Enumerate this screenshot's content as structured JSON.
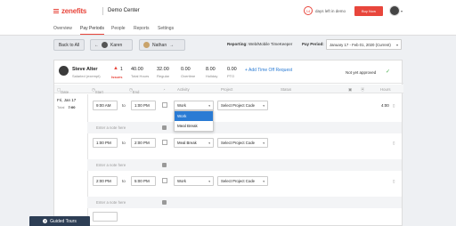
{
  "brand": {
    "name": "zenefits",
    "company": "Demo Center"
  },
  "trial": {
    "days": "14",
    "text": "days left in demo",
    "buy_label": "Buy Now"
  },
  "nav": [
    "Overview",
    "Pay Periods",
    "People",
    "Reports",
    "Settings"
  ],
  "toolbar": {
    "back_label": "Back to All",
    "prev_person": "Karen",
    "next_person": "Nathan",
    "reporting_label": "Reporting:",
    "reporting_value": "Web/Mobile TimeKeeper",
    "pay_period_label": "Pay Period:",
    "pay_period_value": "January 17 - Feb 01, 2020 (Current)"
  },
  "employee": {
    "name": "Steve Alter",
    "type": "Salaried (exempt)",
    "issues_count": "1",
    "issues_label": "Issues",
    "stats": [
      {
        "value": "40.00",
        "label": "Total Hours"
      },
      {
        "value": "32.00",
        "label": "Regular"
      },
      {
        "value": "0.00",
        "label": "Overtime"
      },
      {
        "value": "8.00",
        "label": "Holiday"
      },
      {
        "value": "0.00",
        "label": "PTO"
      }
    ],
    "add_timeoff": "+ Add Time Off Request",
    "status": "Not yet approved"
  },
  "columns": {
    "date": "Date",
    "start": "Start",
    "end": "End",
    "activity": "Activity",
    "project": "Project",
    "status": "Status",
    "hours": "Hours"
  },
  "day": {
    "date": "Fri, Jan 17",
    "total_label": "Total",
    "total_value": "7:00"
  },
  "entries": [
    {
      "start": "9:00 AM",
      "to": "to",
      "end": "1:00 PM",
      "activity": "Work",
      "project": "Select Project Code",
      "hours": "4:00"
    },
    {
      "start": "1:00 PM",
      "to": "to",
      "end": "2:00 PM",
      "activity": "Meal Break",
      "project": "Select Project Code",
      "hours": ""
    },
    {
      "start": "2:00 PM",
      "to": "to",
      "end": "5:00 PM",
      "activity": "Work",
      "project": "Select Project Code",
      "hours": ""
    }
  ],
  "note_placeholder": "Enter a note here",
  "dropdown_options": [
    "Work",
    "Meal Break"
  ],
  "guided_tours": "Guided Tours",
  "colors": {
    "accent": "#e8463c",
    "link": "#2a7bd4",
    "approved": "#4caf50"
  }
}
